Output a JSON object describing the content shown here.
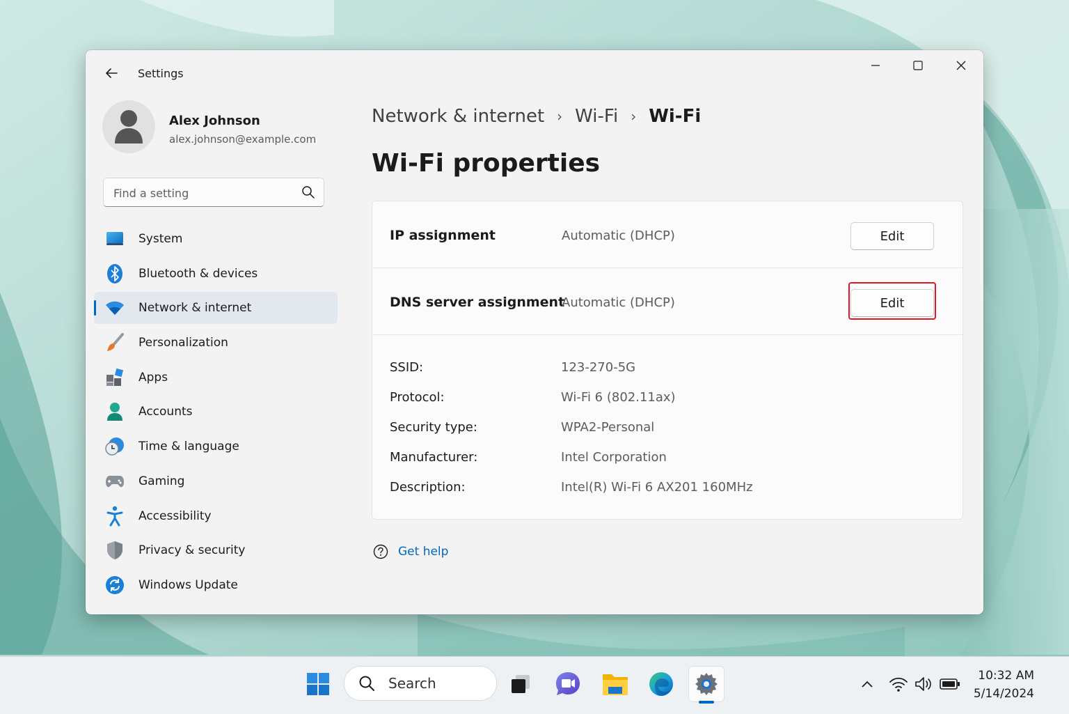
{
  "window": {
    "title": "Settings"
  },
  "profile": {
    "name": "Alex Johnson",
    "email": "alex.johnson@example.com"
  },
  "search": {
    "placeholder": "Find a setting"
  },
  "sidebar": {
    "items": [
      {
        "label": "System",
        "icon": "system-icon"
      },
      {
        "label": "Bluetooth & devices",
        "icon": "bluetooth-icon"
      },
      {
        "label": "Network & internet",
        "icon": "wifi-icon",
        "selected": true
      },
      {
        "label": "Personalization",
        "icon": "paintbrush-icon"
      },
      {
        "label": "Apps",
        "icon": "apps-icon"
      },
      {
        "label": "Accounts",
        "icon": "person-icon"
      },
      {
        "label": "Time & language",
        "icon": "clock-globe-icon"
      },
      {
        "label": "Gaming",
        "icon": "gamepad-icon"
      },
      {
        "label": "Accessibility",
        "icon": "accessibility-icon"
      },
      {
        "label": "Privacy & security",
        "icon": "shield-icon"
      },
      {
        "label": "Windows Update",
        "icon": "sync-icon"
      }
    ]
  },
  "breadcrumb": [
    "Network & internet",
    "Wi-Fi",
    "Wi-Fi"
  ],
  "page_title": "Wi-Fi properties",
  "ip_assignment": {
    "label": "IP assignment",
    "value": "Automatic (DHCP)",
    "button": "Edit"
  },
  "dns_assignment": {
    "label": "DNS server assignment",
    "value": "Automatic (DHCP)",
    "button": "Edit"
  },
  "properties": [
    {
      "label": "SSID:",
      "value": "123-270-5G"
    },
    {
      "label": "Protocol:",
      "value": "Wi-Fi 6 (802.11ax)"
    },
    {
      "label": "Security type:",
      "value": "WPA2-Personal"
    },
    {
      "label": "Manufacturer:",
      "value": "Intel Corporation"
    },
    {
      "label": "Description:",
      "value": "Intel(R) Wi-Fi 6 AX201 160MHz"
    }
  ],
  "help": {
    "label": "Get help"
  },
  "taskbar": {
    "search_label": "Search",
    "time": "10:32 AM",
    "date": "5/14/2024"
  },
  "colors": {
    "accent": "#0067c0",
    "highlight": "#e0162b"
  }
}
